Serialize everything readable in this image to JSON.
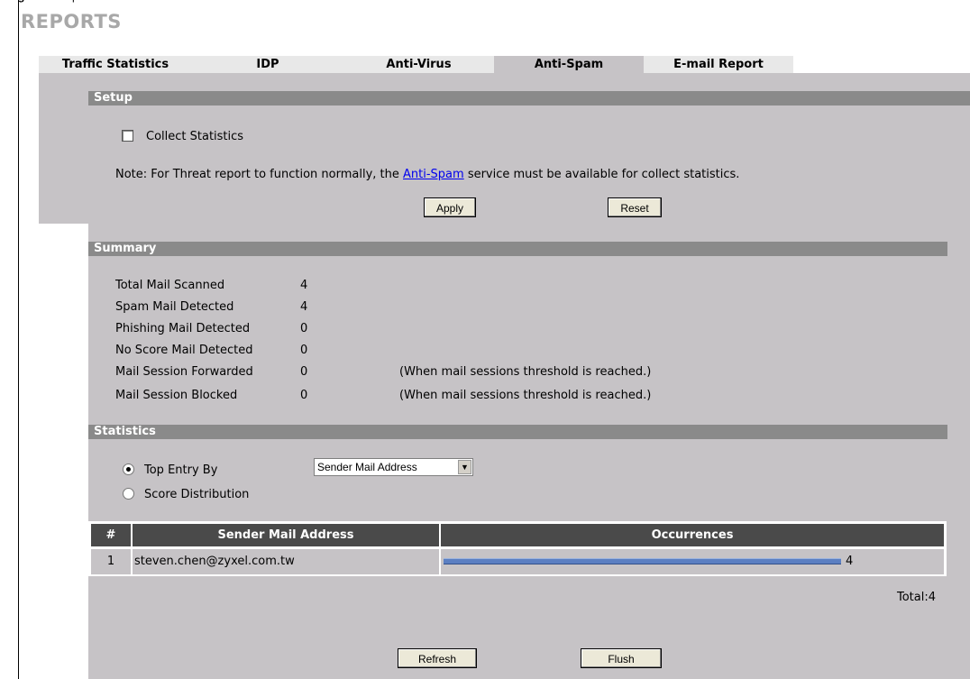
{
  "top_caption": {
    "prefix": "g",
    "text": "p"
  },
  "page_title": "REPORTS",
  "tabs": [
    {
      "label": "Traffic Statistics",
      "active": false
    },
    {
      "label": "IDP",
      "active": false
    },
    {
      "label": "Anti-Virus",
      "active": false
    },
    {
      "label": "Anti-Spam",
      "active": true
    },
    {
      "label": "E-mail Report",
      "active": false
    }
  ],
  "setup": {
    "title": "Setup",
    "collect_label": "Collect Statistics",
    "collect_checked": false,
    "note_before": "Note: For Threat report to function normally, the ",
    "note_link": "Anti-Spam",
    "note_after": " service must be available for collect statistics.",
    "apply_label": "Apply",
    "reset_label": "Reset"
  },
  "summary": {
    "title": "Summary",
    "rows": [
      {
        "label": "Total Mail Scanned",
        "value": "4",
        "note": ""
      },
      {
        "label": "Spam Mail Detected",
        "value": "4",
        "note": ""
      },
      {
        "label": "Phishing Mail Detected",
        "value": "0",
        "note": ""
      },
      {
        "label": "No Score Mail Detected",
        "value": "0",
        "note": ""
      },
      {
        "label": "Mail Session Forwarded",
        "value": "0",
        "note": "(When mail sessions threshold is reached.)"
      },
      {
        "label": "Mail Session Blocked",
        "value": "0",
        "note": "(When mail sessions threshold is reached.)"
      }
    ]
  },
  "statistics": {
    "title": "Statistics",
    "top_entry_label": "Top Entry By",
    "score_distribution_label": "Score Distribution",
    "selected_option": "Sender Mail Address",
    "table": {
      "headers": [
        "#",
        "Sender Mail Address",
        "Occurrences"
      ],
      "rows": [
        {
          "index": "1",
          "address": "steven.chen@zyxel.com.tw",
          "occurrences": "4",
          "bar_fraction": 1.0
        }
      ]
    },
    "total": "Total:4",
    "refresh_label": "Refresh",
    "flush_label": "Flush"
  },
  "colors": {
    "section_bar": "#8a8a8a",
    "panel": "#c6c3c6",
    "table_header": "#4a4a4a",
    "bar": "#5b7fc2",
    "link": "#0000ee"
  }
}
